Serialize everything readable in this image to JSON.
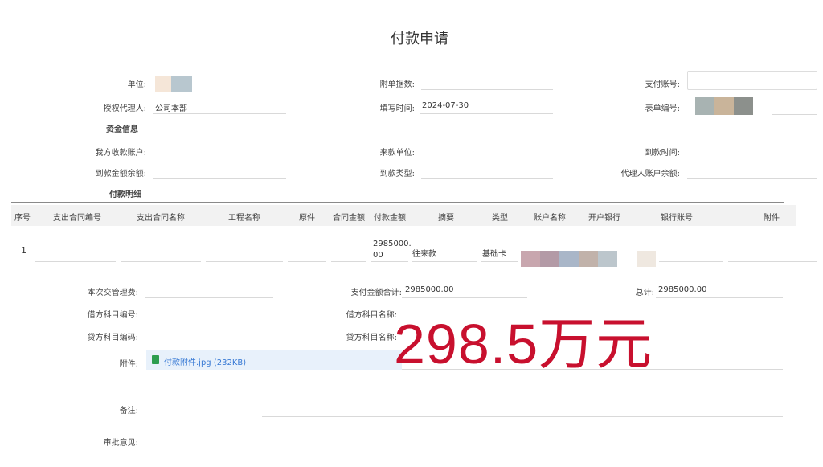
{
  "page_title": "付款申请",
  "form": {
    "unit_label": "单位:",
    "attachments_count_label": "附单据数:",
    "pay_account_label": "支付账号:",
    "agent_label": "授权代理人:",
    "agent_value": "公司本部",
    "fill_date_label": "填写时间:",
    "fill_date_value": "2024-07-30",
    "form_no_label": "表单编号:"
  },
  "fund_info": {
    "section_title": "资金信息",
    "our_account_label": "我方收款账户:",
    "payer_unit_label": "来款单位:",
    "arrival_time_label": "到款时间:",
    "arrival_balance_label": "到款金额余额:",
    "arrival_type_label": "到款类型:",
    "agent_balance_label": "代理人账户余额:"
  },
  "payment_detail": {
    "section_title": "付款明细",
    "columns": [
      "序号",
      "支出合同编号",
      "支出合同名称",
      "工程名称",
      "原件",
      "合同金额",
      "付款金额",
      "摘要",
      "类型",
      "账户名称",
      "开户银行",
      "银行账号",
      "附件"
    ],
    "rows": [
      {
        "index": "1",
        "amount_line1": "2985000.",
        "amount_line2": "00",
        "summary": "往来款",
        "type": "基础卡"
      }
    ]
  },
  "footer": {
    "handling_fee_label": "本次交管理费:",
    "pay_total_label": "支付金额合计:",
    "pay_total_value": "2985000.00",
    "sum_label": "总计:",
    "sum_value": "2985000.00",
    "debit_code_label": "借方科目编号:",
    "debit_name_label": "借方科目名称:",
    "credit_code_label": "贷方科目编码:",
    "credit_name_label": "贷方科目名称:",
    "attachment_label": "附件:",
    "attachment_file": "付款附件.jpg (232KB)",
    "remark_label": "备注:",
    "approval_label": "审批意见:"
  },
  "annotation": {
    "text": "298.5万元",
    "color": "#c8102e"
  },
  "colors": {
    "accent_link": "#3a7bd5",
    "attachment_bg": "#e8f1fb",
    "file_icon": "#2e9e4f"
  }
}
